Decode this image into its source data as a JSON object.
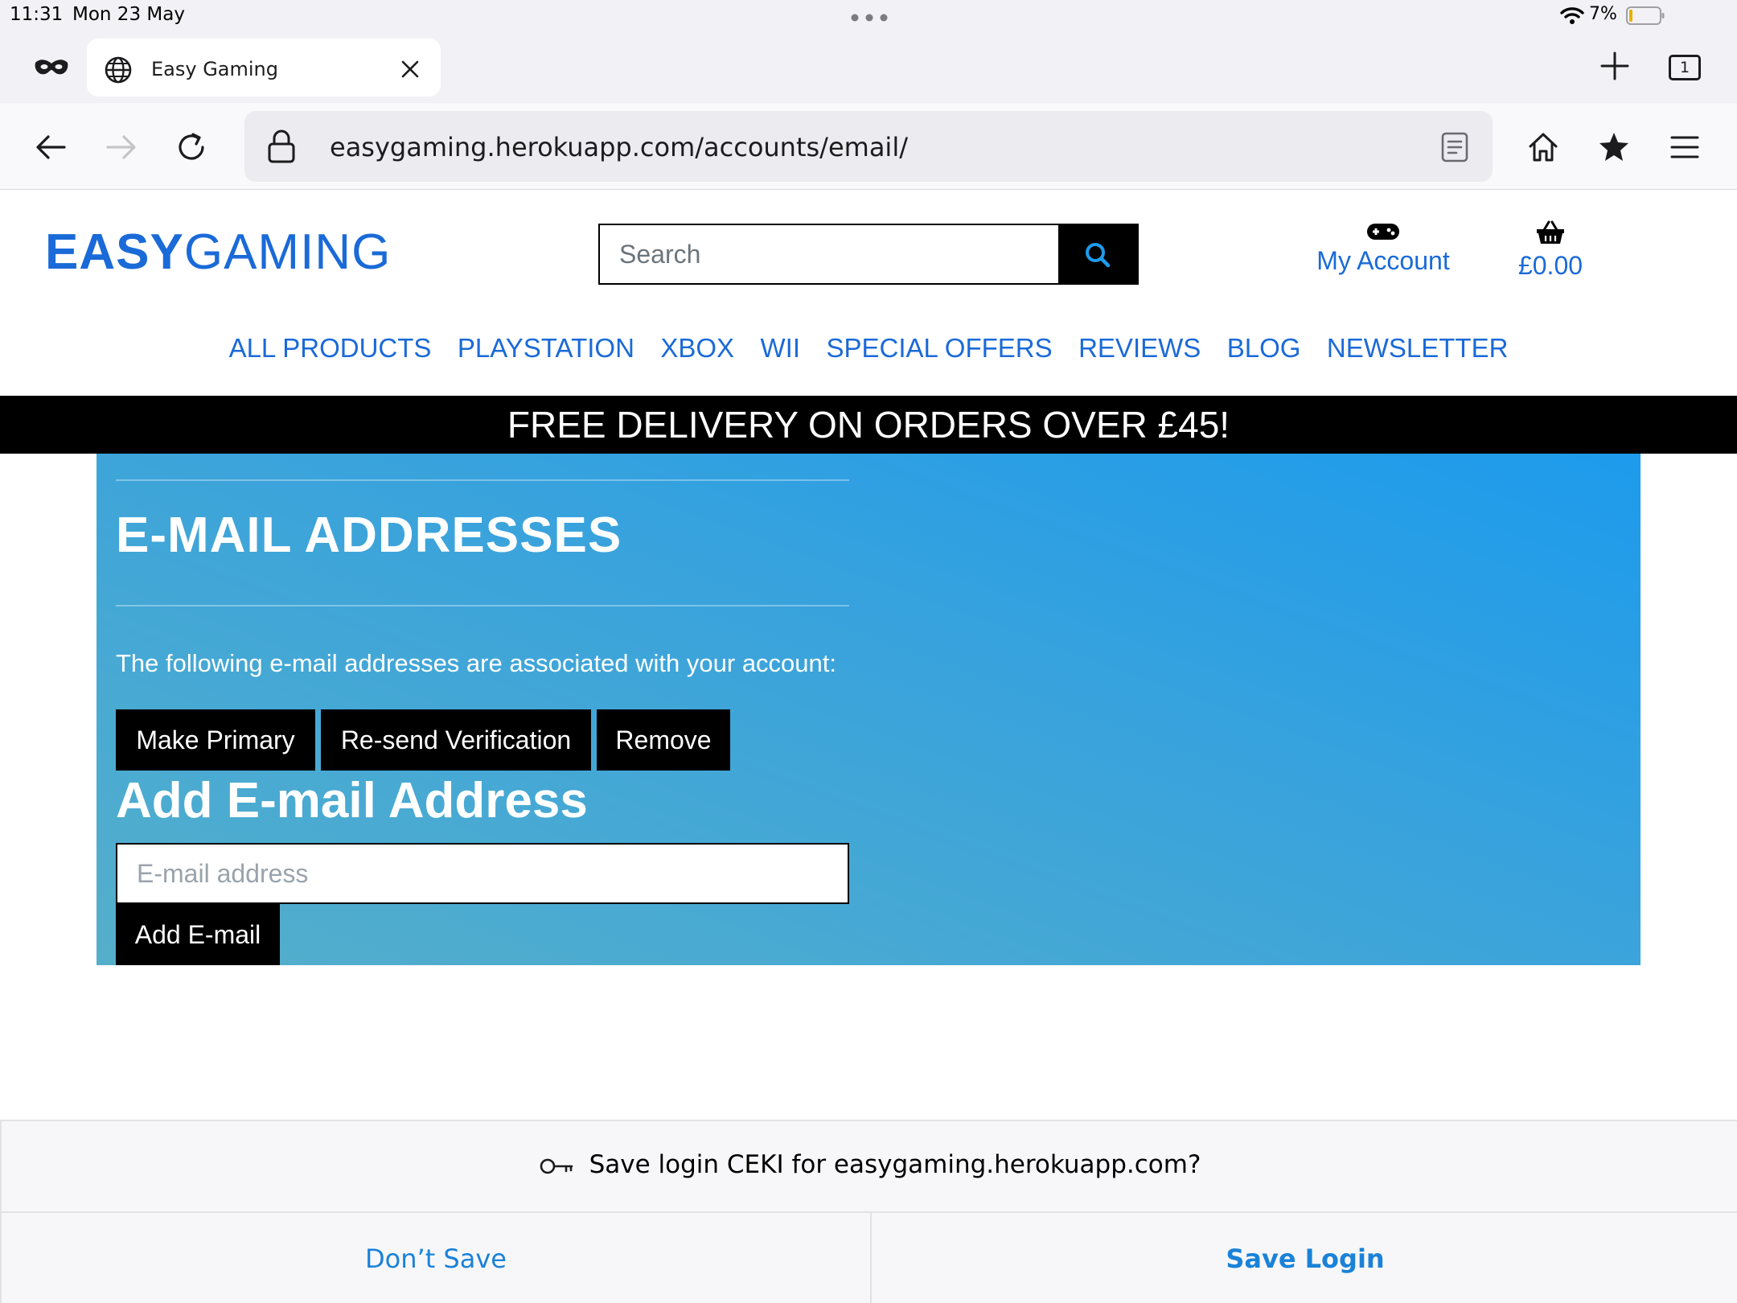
{
  "status_bar": {
    "time": "11:31",
    "date": "Mon 23 May",
    "battery": "7%"
  },
  "browser": {
    "tab_title": "Easy Gaming",
    "tab_count": "1",
    "url": "easygaming.herokuapp.com/accounts/email/",
    "icons": [
      "private-mask-icon",
      "globe-icon",
      "close-icon",
      "plus-icon",
      "back-icon",
      "forward-icon",
      "reload-icon",
      "lock-icon",
      "reader-icon",
      "home-icon",
      "bookmark-star-icon",
      "menu-icon"
    ]
  },
  "site": {
    "logo_part1": "EASY",
    "logo_part2": "GAMING",
    "search_placeholder": "Search",
    "account_label": "My Account",
    "basket_total": "£0.00",
    "nav": [
      "ALL PRODUCTS",
      "PLAYSTATION",
      "XBOX",
      "WII",
      "SPECIAL OFFERS",
      "REVIEWS",
      "BLOG",
      "NEWSLETTER"
    ],
    "banner": "FREE DELIVERY ON ORDERS OVER £45!",
    "accent_color": "#1a6ad8"
  },
  "main": {
    "title": "E-MAIL ADDRESSES",
    "lead": "The following e-mail addresses are associated with your account:",
    "buttons": {
      "make_primary": "Make Primary",
      "resend": "Re-send Verification",
      "remove": "Remove"
    },
    "add_title": "Add E-mail Address",
    "email_placeholder": "E-mail address",
    "add_button": "Add E-mail"
  },
  "save_prompt": {
    "message": "Save login CEKI for easygaming.herokuapp.com?",
    "dont_save": "Don’t Save",
    "save_login": "Save Login"
  }
}
